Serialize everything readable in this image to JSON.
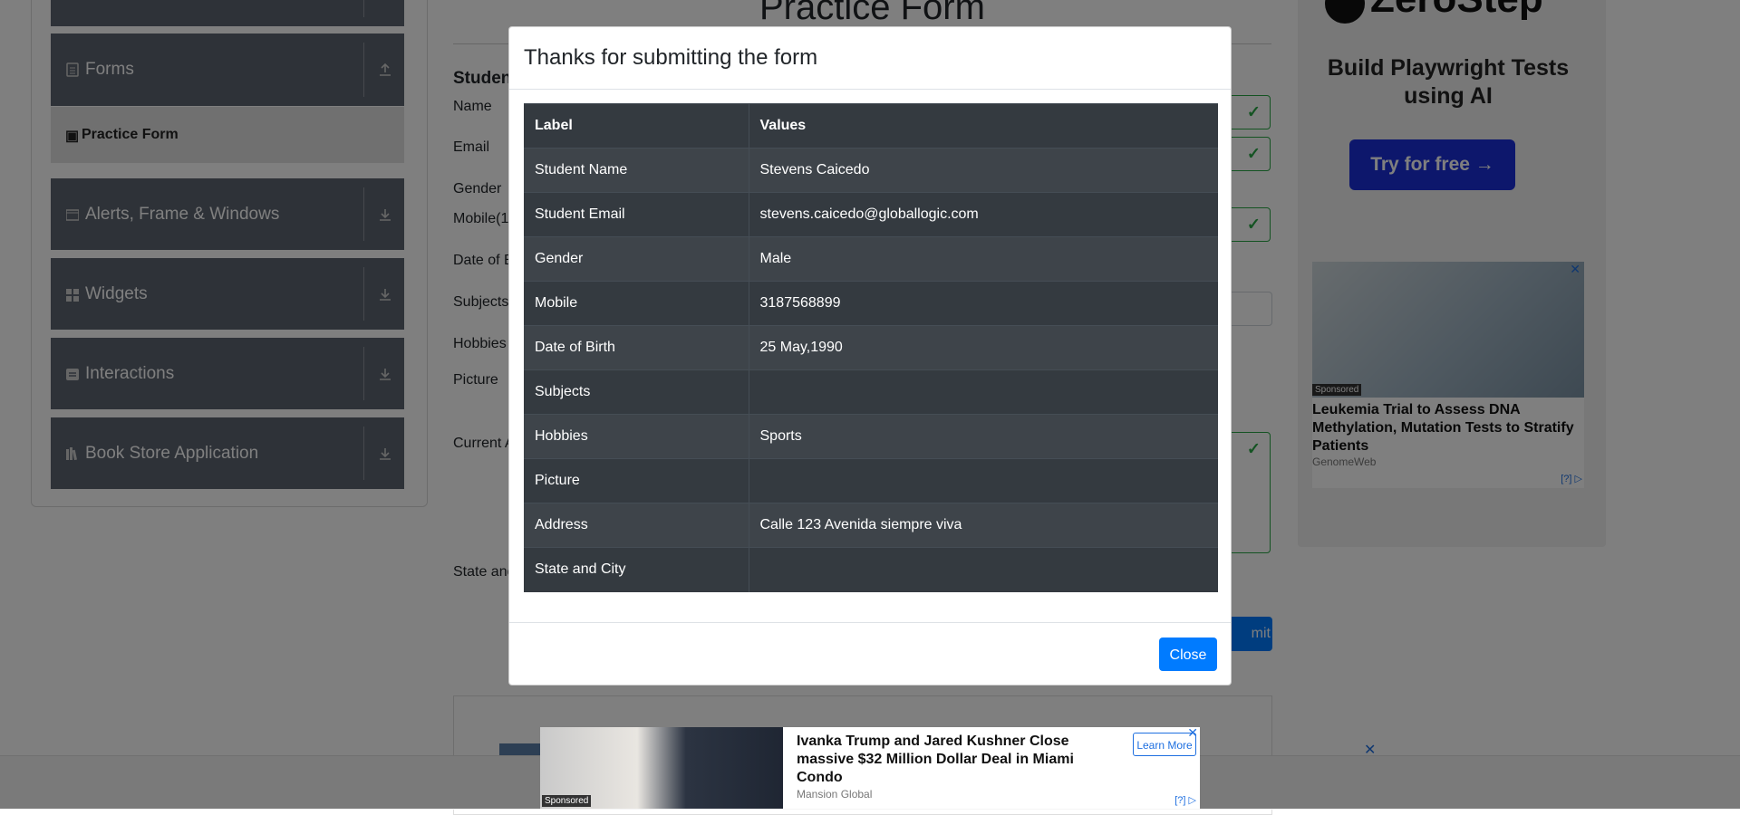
{
  "sidebar": {
    "groups": [
      {
        "label": "Forms",
        "icon": "document-icon",
        "arrow": "upload-arrow-icon"
      },
      {
        "label": "Alerts, Frame & Windows",
        "icon": "window-icon",
        "arrow": "download-arrow-icon"
      },
      {
        "label": "Widgets",
        "icon": "grid-icon",
        "arrow": "download-arrow-icon"
      },
      {
        "label": "Interactions",
        "icon": "swap-icon",
        "arrow": "download-arrow-icon"
      },
      {
        "label": "Book Store Application",
        "icon": "books-icon",
        "arrow": "download-arrow-icon"
      }
    ],
    "active_item": {
      "label": "Practice Form",
      "icon": "html-icon"
    }
  },
  "form": {
    "title": "Practice Form",
    "section_label": "Studen",
    "labels": {
      "name": "Name",
      "email": "Email",
      "gender": "Gender",
      "mobile": "Mobile(1",
      "dob": "Date of B",
      "subjects": "Subjects",
      "hobbies": "Hobbies",
      "picture": "Picture",
      "current_address": "Current A",
      "state": "State and"
    },
    "submit_label": "mit"
  },
  "right_ad": {
    "brand": "ZeroStep",
    "tagline": "Build Playwright Tests using AI",
    "cta": "Try for free →",
    "inner_ad": {
      "sponsored": "Sponsored",
      "headline": "Leukemia Trial to Assess DNA Methylation, Mutation Tests to Stratify Patients",
      "source": "GenomeWeb",
      "ad_choices": "[?]"
    }
  },
  "modal": {
    "title": "Thanks for submitting the form",
    "columns": [
      "Label",
      "Values"
    ],
    "rows": [
      {
        "label": "Student Name",
        "value": "Stevens Caicedo"
      },
      {
        "label": "Student Email",
        "value": "stevens.caicedo@globallogic.com"
      },
      {
        "label": "Gender",
        "value": "Male"
      },
      {
        "label": "Mobile",
        "value": "3187568899"
      },
      {
        "label": "Date of Birth",
        "value": "25 May,1990"
      },
      {
        "label": "Subjects",
        "value": ""
      },
      {
        "label": "Hobbies",
        "value": "Sports"
      },
      {
        "label": "Picture",
        "value": ""
      },
      {
        "label": "Address",
        "value": "Calle 123 Avenida siempre viva"
      },
      {
        "label": "State and City",
        "value": ""
      }
    ],
    "close_label": "Close"
  },
  "bottom_ad": {
    "sponsored": "Sponsored",
    "headline": "Ivanka Trump and Jared Kushner Close massive $32 Million Dollar Deal in Miami Condo",
    "source": "Mansion Global",
    "cta": "Learn More",
    "ad_choices": "[?]"
  },
  "colors": {
    "primary": "#007bff",
    "dark_table": "#343a40",
    "valid_green": "#28a745",
    "sidebar_group": "#5c6470"
  }
}
